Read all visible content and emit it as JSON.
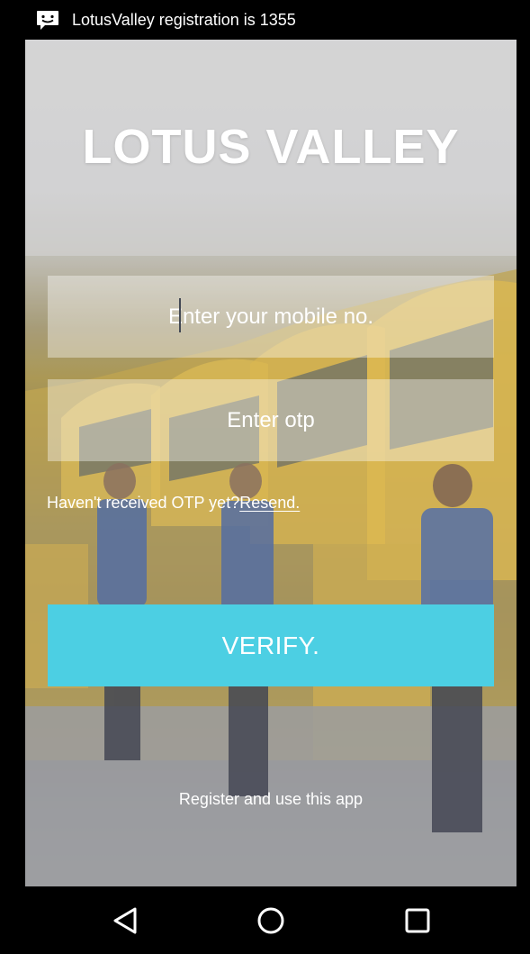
{
  "status_bar": {
    "notification_icon": "message-icon",
    "notification_text": "LotusValley registration is 1355"
  },
  "app": {
    "logo_text": "LOTUS VALLEY",
    "mobile_input": {
      "placeholder": "Enter your mobile no.",
      "value": ""
    },
    "otp_input": {
      "placeholder": "Enter otp",
      "value": ""
    },
    "resend_prompt": "Haven't received OTP yet?",
    "resend_link": "Resend.",
    "verify_button": "VERIFY.",
    "register_link": "Register and use this app",
    "accent_color": "#4ccfe3"
  },
  "nav_bar": {
    "back_icon": "back-triangle-icon",
    "home_icon": "home-circle-icon",
    "recents_icon": "recents-square-icon"
  }
}
